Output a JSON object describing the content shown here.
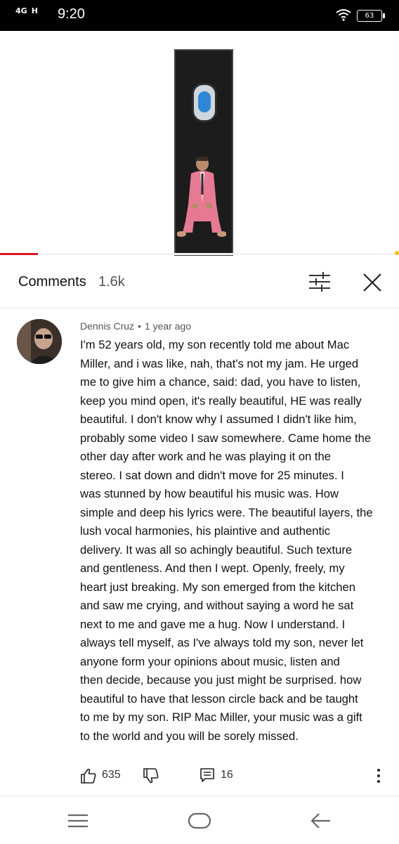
{
  "status_bar": {
    "network_1": "4G",
    "network_2": "H",
    "time": "9:20",
    "battery": "63"
  },
  "comments_panel": {
    "title": "Comments",
    "count": "1.6k"
  },
  "comment": {
    "author": "Dennis Cruz",
    "separator": "•",
    "age": "1 year ago",
    "lines": [
      "I'm 52 years old, my son recently told me about Mac",
      "Miller, and i was like, nah, that's not my jam. He urged",
      "me to give him a chance, said: dad, you have to listen,",
      "keep you mind open, it's really beautiful, HE was really",
      "beautiful. I don't know why I assumed I didn't like him,",
      "probably some video I saw somewhere.  Came home the",
      "other day after work and he was playing it on the",
      "stereo.  I sat down and didn't move for 25 minutes. I",
      "was stunned by how beautiful his music was. How",
      "simple and deep his lyrics were. The beautiful layers, the",
      "lush vocal harmonies, his plaintive and authentic",
      "delivery. It was all so achingly beautiful. Such texture",
      "and gentleness.  And then I wept. Openly, freely, my",
      "heart just breaking. My son emerged from the kitchen",
      "and saw me crying, and without saying a word he sat",
      "next to me and gave me a hug.  Now I understand. I",
      "always tell myself, as I've always told my son, never let",
      "anyone form your opinions about music,  listen and",
      "then decide, because you just might be surprised. how",
      "beautiful to have that lesson circle back and be taught",
      "to me by my son. RIP Mac Miller, your music was a gift",
      "to the world and you will be sorely missed."
    ],
    "likes": "635",
    "replies": "16"
  },
  "video": {
    "progress_percent": 9.5
  },
  "colors": {
    "progress_red": "#e1141f",
    "status_bar_bg": "#000000"
  },
  "icons": {
    "wifi": "wifi-icon",
    "battery": "battery-icon",
    "filter": "filter-icon",
    "close": "close-icon",
    "like": "thumbs-up-icon",
    "dislike": "thumbs-down-icon",
    "reply": "reply-icon",
    "more": "more-vertical-icon",
    "nav_menu": "menu-icon",
    "nav_home": "home-icon",
    "nav_back": "back-icon"
  }
}
